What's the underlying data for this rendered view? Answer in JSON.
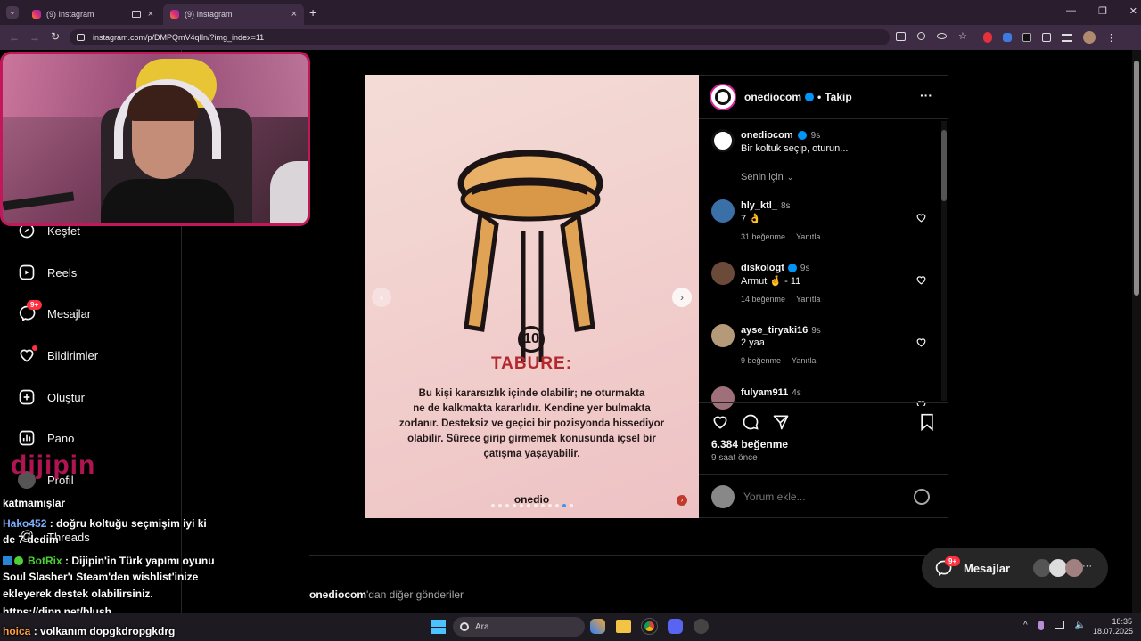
{
  "browser": {
    "tabs": [
      {
        "title": "(9) Instagram"
      },
      {
        "title": "(9) Instagram"
      }
    ],
    "url": "instagram.com/p/DMPQmV4qIln/?img_index=11"
  },
  "sidebar": {
    "items": [
      {
        "label": "Keşfet",
        "icon": "compass-icon"
      },
      {
        "label": "Reels",
        "icon": "reels-icon"
      },
      {
        "label": "Mesajlar",
        "icon": "messenger-icon",
        "badge": "9+"
      },
      {
        "label": "Bildirimler",
        "icon": "heart-icon"
      },
      {
        "label": "Oluştur",
        "icon": "plus-square-icon"
      },
      {
        "label": "Pano",
        "icon": "dashboard-icon"
      },
      {
        "label": "Profil",
        "icon": "avatar-icon"
      },
      {
        "label": "Threads",
        "icon": "threads-icon"
      }
    ]
  },
  "overlay": {
    "logo_text": "dijipin",
    "chat": [
      {
        "user": "",
        "text": "katmamışlar"
      },
      {
        "user": "Hako452",
        "text": ": doğru koltuğu seçmişim iyi ki"
      },
      {
        "user": "",
        "text": "de 7 dedim"
      },
      {
        "user": "BotRix",
        "text": ": Dijipin'in Türk yapımı oyunu"
      },
      {
        "user": "",
        "text": "Soul Slasher'ı Steam'den wishlist'inize"
      },
      {
        "user": "",
        "text": "ekleyerek destek olabilirsiniz."
      },
      {
        "user": "",
        "text": "https://djpn.net/blush"
      },
      {
        "user": "hoica",
        "text": ": volkanım dopgkdropgkdrg"
      }
    ],
    "user_colors": {
      "Hako452": "#7fb0ff",
      "BotRix": "#4cd137",
      "hoica": "#ff9f43"
    }
  },
  "post": {
    "number": "10",
    "heading": "TABURE:",
    "body_lines": [
      "Bu kişi kararsızlık içinde olabilir; ne oturmakta",
      "ne de kalkmakta kararlıdır. Kendine yer bulmakta",
      "zorlanır. Desteksiz ve geçici bir pozisyonda hissediyor",
      "olabilir. Sürece girip girmemek konusunda içsel bir",
      "çatışma yaşayabilir."
    ],
    "brand": "onedio",
    "slide_count": 12,
    "active_slide": 11,
    "account": "onediocom",
    "follow": "Takip",
    "separator": "•",
    "caption": {
      "user": "onediocom",
      "time": "9s",
      "text": "Bir koltuk seçip, oturun..."
    },
    "filter": "Senin için",
    "comments": [
      {
        "user": "hly_ktl_",
        "time": "8s",
        "text": "7 👌",
        "likes": "31 beğenme",
        "reply": "Yanıtla",
        "verified": false,
        "avatar_color": "#3a6fa8"
      },
      {
        "user": "diskologt",
        "time": "9s",
        "text": "Armut 🤞 - 11",
        "likes": "14 beğenme",
        "reply": "Yanıtla",
        "verified": true,
        "avatar_color": "#6b4a3a"
      },
      {
        "user": "ayse_tiryaki16",
        "time": "9s",
        "text": "2 yaa",
        "likes": "9 beğenme",
        "reply": "Yanıtla",
        "verified": false,
        "avatar_color": "#b59a7a"
      },
      {
        "user": "fulyam911",
        "time": "4s",
        "text": "",
        "likes": "",
        "reply": "",
        "verified": false,
        "avatar_color": "#a0707a"
      }
    ],
    "likes": "6.384 beğenme",
    "posted": "9 saat önce",
    "comment_placeholder": "Yorum ekle...",
    "more_from": {
      "user": "onediocom",
      "suffix": "'dan diğer gönderiler"
    }
  },
  "messages_widget": {
    "label": "Mesajlar",
    "badge": "9+"
  },
  "taskbar": {
    "search_placeholder": "Ara",
    "time": "18:35",
    "date": "18.07.2025"
  },
  "colors": {
    "brand_red": "#b3282d",
    "accent": "#0095f6",
    "badge": "#ff3040"
  }
}
